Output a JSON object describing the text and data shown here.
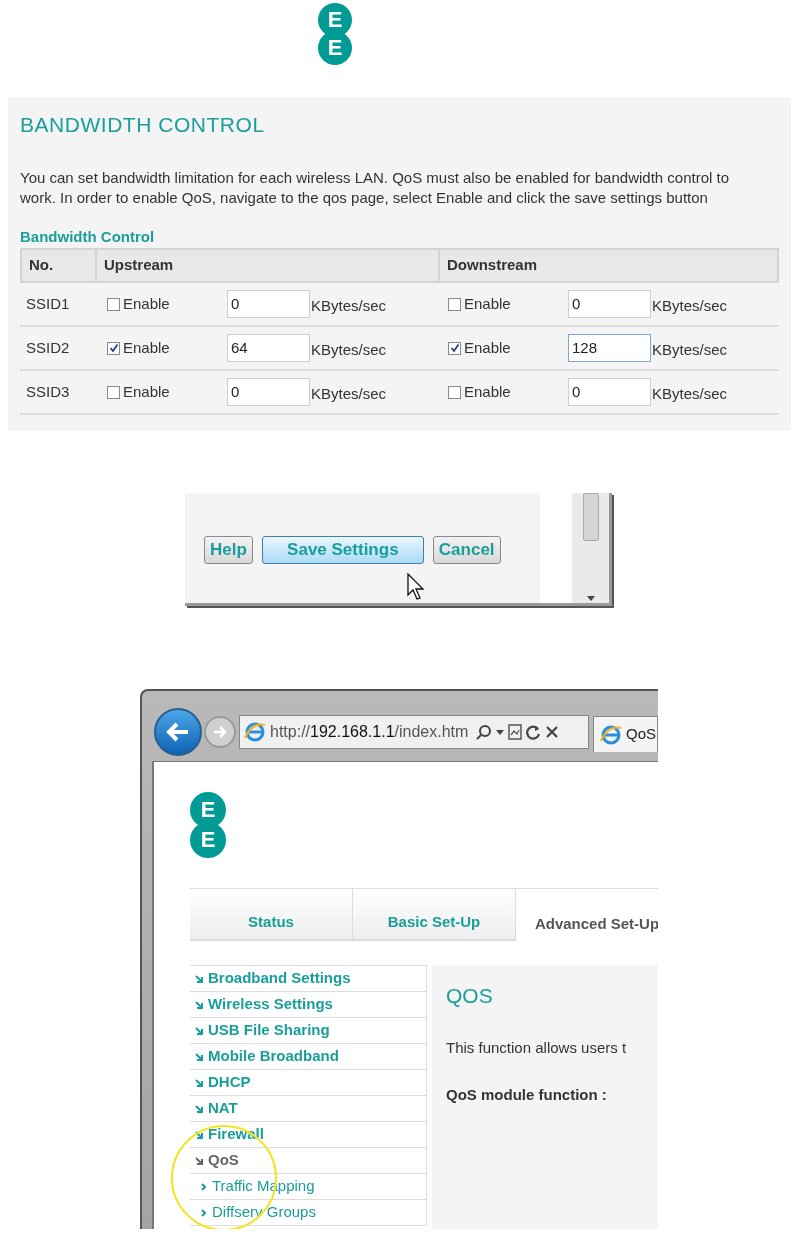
{
  "logo": {
    "letters": [
      "E",
      "E"
    ]
  },
  "bandwidth_page": {
    "title": "BANDWIDTH CONTROL",
    "description": "You can set bandwidth limitation for each wireless LAN. QoS must also be enabled for bandwidth control to work. In order to enable QoS, navigate to the qos page, select Enable and click the save settings button",
    "section_title": "Bandwidth Control",
    "table": {
      "columns": [
        "No.",
        "Upstream",
        "Downstream"
      ],
      "rows": [
        {
          "name": "SSID1",
          "upstream": {
            "checked": false,
            "label": "Enable",
            "value": "0",
            "unit": "KBytes/sec",
            "focused": false
          },
          "downstream": {
            "checked": false,
            "label": "Enable",
            "value": "0",
            "unit": "KBytes/sec",
            "focused": false
          }
        },
        {
          "name": "SSID2",
          "upstream": {
            "checked": true,
            "label": "Enable",
            "value": "64",
            "unit": "KBytes/sec",
            "focused": false
          },
          "downstream": {
            "checked": true,
            "label": "Enable",
            "value": "128",
            "unit": "KBytes/sec",
            "focused": true
          }
        },
        {
          "name": "SSID3",
          "upstream": {
            "checked": false,
            "label": "Enable",
            "value": "0",
            "unit": "KBytes/sec",
            "focused": false
          },
          "downstream": {
            "checked": false,
            "label": "Enable",
            "value": "0",
            "unit": "KBytes/sec",
            "focused": false
          }
        }
      ]
    }
  },
  "buttons_panel": {
    "buttons": [
      {
        "label": "Help",
        "hovered": false
      },
      {
        "label": "Save Settings",
        "hovered": true
      },
      {
        "label": "Cancel",
        "hovered": false
      }
    ]
  },
  "browser": {
    "url": {
      "scheme": "http://",
      "host": "192.168.1.1",
      "path": "/index.htm"
    },
    "tab_title": "QoS",
    "logo": {
      "letters": [
        "E",
        "E"
      ]
    },
    "tabs": [
      {
        "label": "Status",
        "selected": false
      },
      {
        "label": "Basic Set-Up",
        "selected": false
      },
      {
        "label": "Advanced Set-Up",
        "selected": true
      }
    ],
    "sidebar": {
      "items": [
        {
          "label": "Broadband Settings",
          "selected": false
        },
        {
          "label": "Wireless Settings",
          "selected": false
        },
        {
          "label": "USB File Sharing",
          "selected": false
        },
        {
          "label": "Mobile Broadband",
          "selected": false
        },
        {
          "label": "DHCP",
          "selected": false
        },
        {
          "label": "NAT",
          "selected": false
        },
        {
          "label": "Firewall",
          "selected": false
        },
        {
          "label": "QoS",
          "selected": true,
          "children": [
            {
              "label": "Traffic Mapping",
              "selected": false
            },
            {
              "label": "Diffserv Groups",
              "selected": false
            }
          ]
        }
      ]
    },
    "content": {
      "title": "QOS",
      "description": "This function allows users t",
      "field_label": "QoS module function :"
    }
  }
}
